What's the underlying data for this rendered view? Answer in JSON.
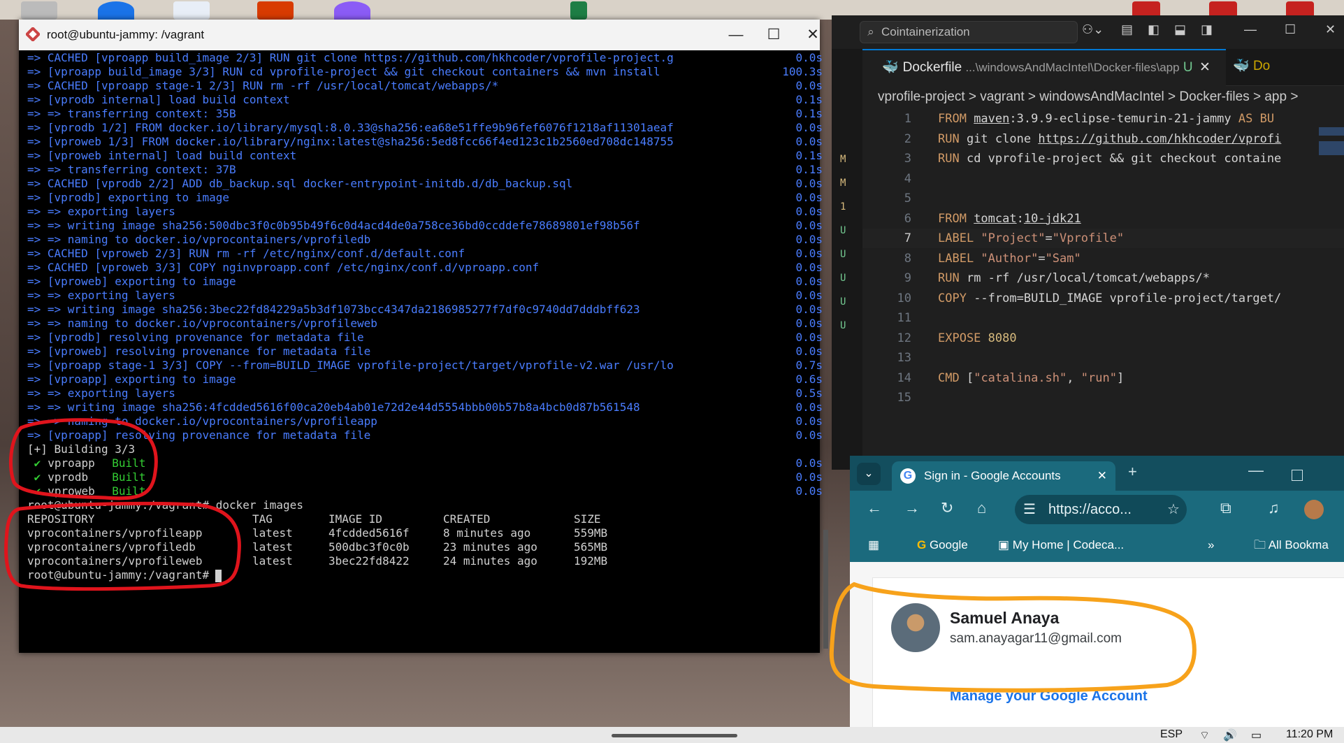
{
  "terminal": {
    "title": "root@ubuntu-jammy: /vagrant",
    "controls": {
      "minimize": "—",
      "maximize": "☐",
      "close": "✕"
    },
    "build_lines": [
      {
        "text": "=> CACHED [vproapp build_image 2/3] RUN git clone https://github.com/hkhcoder/vprofile-project.g",
        "time": "0.0s"
      },
      {
        "text": "=> [vproapp build_image 3/3] RUN cd vprofile-project && git checkout containers && mvn install",
        "time": "100.3s"
      },
      {
        "text": "=> CACHED [vproapp stage-1 2/3] RUN rm -rf /usr/local/tomcat/webapps/*",
        "time": "0.0s"
      },
      {
        "text": "=> [vprodb internal] load build context",
        "time": "0.1s"
      },
      {
        "text": "=> => transferring context: 35B",
        "time": "0.1s"
      },
      {
        "text": "=> [vprodb 1/2] FROM docker.io/library/mysql:8.0.33@sha256:ea68e51ffe9b96fef6076f1218af11301aeaf",
        "time": "0.0s"
      },
      {
        "text": "=> [vproweb 1/3] FROM docker.io/library/nginx:latest@sha256:5ed8fcc66f4ed123c1b2560ed708dc148755",
        "time": "0.0s"
      },
      {
        "text": "=> [vproweb internal] load build context",
        "time": "0.1s"
      },
      {
        "text": "=> => transferring context: 37B",
        "time": "0.1s"
      },
      {
        "text": "=> CACHED [vprodb 2/2] ADD db_backup.sql docker-entrypoint-initdb.d/db_backup.sql",
        "time": "0.0s"
      },
      {
        "text": "=> [vprodb] exporting to image",
        "time": "0.0s"
      },
      {
        "text": "=> => exporting layers",
        "time": "0.0s"
      },
      {
        "text": "=> => writing image sha256:500dbc3f0c0b95b49f6c0d4acd4de0a758ce36bd0ccddefe78689801ef98b56f",
        "time": "0.0s"
      },
      {
        "text": "=> => naming to docker.io/vprocontainers/vprofiledb",
        "time": "0.0s"
      },
      {
        "text": "=> CACHED [vproweb 2/3] RUN rm -rf /etc/nginx/conf.d/default.conf",
        "time": "0.0s"
      },
      {
        "text": "=> CACHED [vproweb 3/3] COPY nginvproapp.conf /etc/nginx/conf.d/vproapp.conf",
        "time": "0.0s"
      },
      {
        "text": "=> [vproweb] exporting to image",
        "time": "0.0s"
      },
      {
        "text": "=> => exporting layers",
        "time": "0.0s"
      },
      {
        "text": "=> => writing image sha256:3bec22fd84229a5b3df1073bcc4347da2186985277f7df0c9740dd7dddbff623",
        "time": "0.0s"
      },
      {
        "text": "=> => naming to docker.io/vprocontainers/vprofileweb",
        "time": "0.0s"
      },
      {
        "text": "=> [vprodb] resolving provenance for metadata file",
        "time": "0.0s"
      },
      {
        "text": "=> [vproweb] resolving provenance for metadata file",
        "time": "0.0s"
      },
      {
        "text": "=> [vproapp stage-1 3/3] COPY --from=BUILD_IMAGE vprofile-project/target/vprofile-v2.war /usr/lo",
        "time": "0.7s"
      },
      {
        "text": "=> [vproapp] exporting to image",
        "time": "0.6s"
      },
      {
        "text": "=> => exporting layers",
        "time": "0.5s"
      },
      {
        "text": "=> => writing image sha256:4fcdded5616f00ca20eb4ab01e72d2e44d5554bbb00b57b8a4bcb0d87b561548",
        "time": "0.0s"
      },
      {
        "text": "=> => naming to docker.io/vprocontainers/vprofileapp",
        "time": "0.0s"
      },
      {
        "text": "=> [vproapp] resolving provenance for metadata file",
        "time": "0.0s"
      }
    ],
    "building_header": "[+] Building 3/3",
    "built_services": [
      {
        "name": "vproapp",
        "status": "Built",
        "time": "0.0s"
      },
      {
        "name": "vprodb",
        "status": "Built",
        "time": "0.0s"
      },
      {
        "name": "vproweb",
        "status": "Built",
        "time": "0.0s"
      }
    ],
    "check_glyph": "✔",
    "command_line": "root@ubuntu-jammy:/vagrant# docker images",
    "images_header": {
      "repository": "REPOSITORY",
      "tag": "TAG",
      "image_id": "IMAGE ID",
      "created": "CREATED",
      "size": "SIZE"
    },
    "images": [
      {
        "repository": "vprocontainers/vprofileapp",
        "tag": "latest",
        "image_id": "4fcdded5616f",
        "created": "8 minutes ago",
        "size": "559MB"
      },
      {
        "repository": "vprocontainers/vprofiledb",
        "tag": "latest",
        "image_id": "500dbc3f0c0b",
        "created": "23 minutes ago",
        "size": "565MB"
      },
      {
        "repository": "vprocontainers/vprofileweb",
        "tag": "latest",
        "image_id": "3bec22fd8422",
        "created": "24 minutes ago",
        "size": "192MB"
      }
    ],
    "prompt": "root@ubuntu-jammy:/vagrant#"
  },
  "vscode": {
    "search": "Cointainerization",
    "tab_title": "Dockerfile",
    "tab_path": "...\\windowsAndMacIntel\\Docker-files\\app",
    "tab_status": "U",
    "tab2_label": "Do",
    "breadcrumb": "vprofile-project > vagrant > windowsAndMacIntel > Docker-files > app >",
    "scm_marks": [
      "M",
      "M",
      "1",
      "U",
      "U",
      "U",
      "U",
      "U"
    ],
    "code": [
      {
        "n": "1",
        "parts": [
          [
            "kw",
            "FROM "
          ],
          [
            "link",
            "maven"
          ],
          [
            "plain",
            ":3.9.9-eclipse-temurin-21-jammy "
          ],
          [
            "kw",
            "AS BU"
          ]
        ]
      },
      {
        "n": "2",
        "parts": [
          [
            "kw",
            "RUN "
          ],
          [
            "plain",
            "git clone "
          ],
          [
            "link",
            "https://github.com/hkhcoder/vprofi"
          ]
        ]
      },
      {
        "n": "3",
        "parts": [
          [
            "kw",
            "RUN "
          ],
          [
            "plain",
            "cd vprofile-project && git checkout containe"
          ]
        ]
      },
      {
        "n": "4",
        "parts": []
      },
      {
        "n": "5",
        "parts": []
      },
      {
        "n": "6",
        "parts": [
          [
            "kw",
            "FROM "
          ],
          [
            "link",
            "tomcat"
          ],
          [
            "plain",
            ":"
          ],
          [
            "link",
            "10-jdk21"
          ]
        ]
      },
      {
        "n": "7",
        "parts": [
          [
            "kw",
            "LABEL "
          ],
          [
            "str",
            "\"Project\""
          ],
          [
            "plain",
            "="
          ],
          [
            "str",
            "\"Vprofile\""
          ]
        ]
      },
      {
        "n": "8",
        "parts": [
          [
            "kw",
            "LABEL "
          ],
          [
            "str",
            "\"Author\""
          ],
          [
            "plain",
            "="
          ],
          [
            "str",
            "\"Sam\""
          ]
        ]
      },
      {
        "n": "9",
        "parts": [
          [
            "kw",
            "RUN "
          ],
          [
            "plain",
            "rm -rf /usr/local/tomcat/webapps/*"
          ]
        ]
      },
      {
        "n": "10",
        "parts": [
          [
            "kw",
            "COPY "
          ],
          [
            "plain",
            "--from=BUILD_IMAGE vprofile-project/target/"
          ]
        ]
      },
      {
        "n": "11",
        "parts": []
      },
      {
        "n": "12",
        "parts": [
          [
            "kw",
            "EXPOSE "
          ],
          [
            "num",
            "8080"
          ]
        ]
      },
      {
        "n": "13",
        "parts": []
      },
      {
        "n": "14",
        "parts": [
          [
            "kw",
            "CMD "
          ],
          [
            "plain",
            "["
          ],
          [
            "str",
            "\"catalina.sh\""
          ],
          [
            "plain",
            ", "
          ],
          [
            "str",
            "\"run\""
          ],
          [
            "plain",
            "]"
          ]
        ]
      },
      {
        "n": "15",
        "parts": []
      }
    ]
  },
  "chrome": {
    "tab_title": "Sign in - Google Accounts",
    "url": "https://acco...",
    "bookmarks": [
      "Google",
      "My Home | Codeca...",
      "»",
      "All Bookma"
    ],
    "account_name": "Samuel Anaya",
    "account_email": "sam.anayagar11@gmail.com",
    "manage_link": "Manage your Google Account"
  },
  "taskbar": {
    "language": "ESP",
    "time": "11:20 PM"
  },
  "colors": {
    "annotation_red": "#e0141c",
    "annotation_orange": "#f7a21b"
  }
}
